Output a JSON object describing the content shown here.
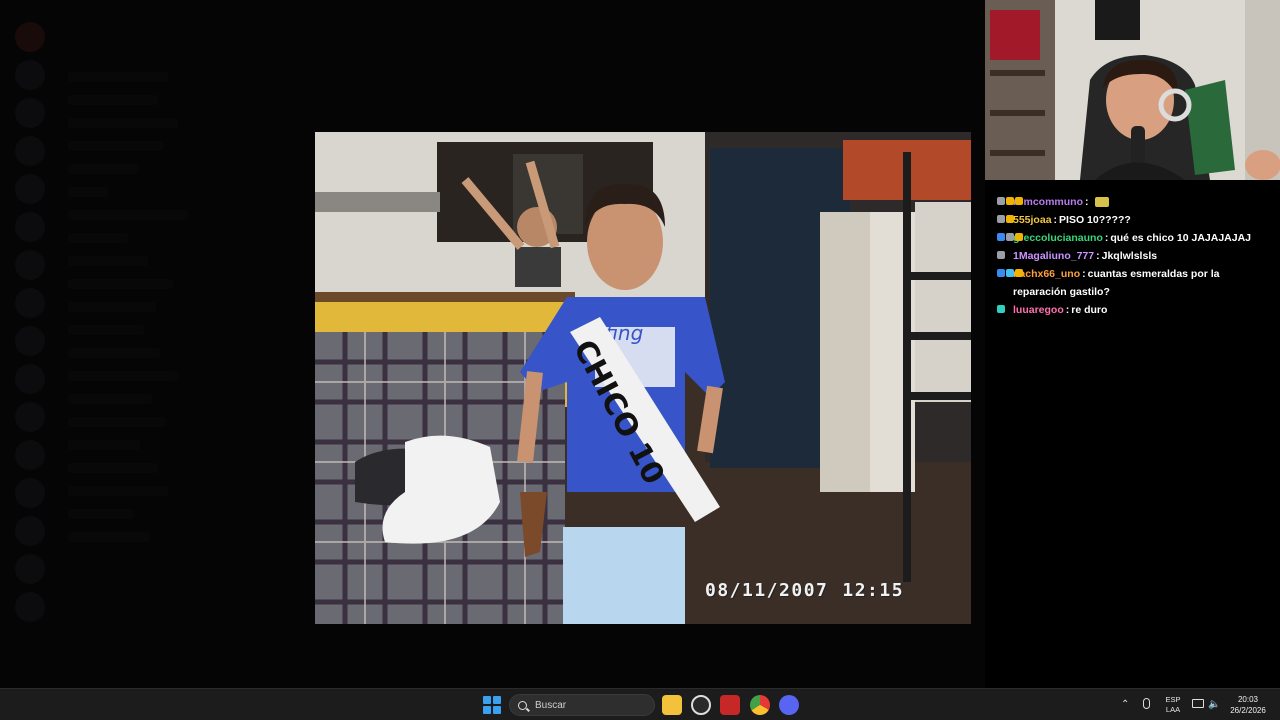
{
  "photo": {
    "date": "08/11/2007",
    "time": "12:15",
    "sash_text": "CHICO 10",
    "shirt_text": "fing"
  },
  "chat": {
    "messages": [
      {
        "user": "romcommuno",
        "text": "",
        "color": "#b77cf0",
        "badges": [
          "#9aa0a6",
          "#f0b400",
          "#f0b400"
        ],
        "emote": true
      },
      {
        "user": "555joaa",
        "text": "PISO 10?????",
        "color": "#f2c744",
        "badges": [
          "#9aa0a6",
          "#f0b400"
        ],
        "emote": false
      },
      {
        "user": "greccolucianauno",
        "text": "qué es chico 10 JAJAJAJAJ",
        "color": "#39d67a",
        "badges": [
          "#3a8bf0",
          "#9aa0a6",
          "#f0b400"
        ],
        "emote": false
      },
      {
        "user": "1Magaliuno_777",
        "text": "Jkqlwlslsls",
        "color": "#c894ff",
        "badges": [
          "#9aa0a6"
        ],
        "emote": false
      },
      {
        "user": "nachx66_uno",
        "text": "cuantas esmeraldas por la reparación gastilo?",
        "color": "#ff9f40",
        "badges": [
          "#3a8bf0",
          "#44c0f0",
          "#f0b400"
        ],
        "emote": false
      },
      {
        "user": "luuaregoo",
        "text": "re duro",
        "color": "#ff6fb0",
        "badges": [
          "#2fd0c0"
        ],
        "emote": false
      }
    ]
  },
  "taskbar": {
    "search_placeholder": "Buscar",
    "lang_line1": "ESP",
    "lang_line2": "LAA",
    "time": "20:03",
    "date": "26/2/2026"
  }
}
